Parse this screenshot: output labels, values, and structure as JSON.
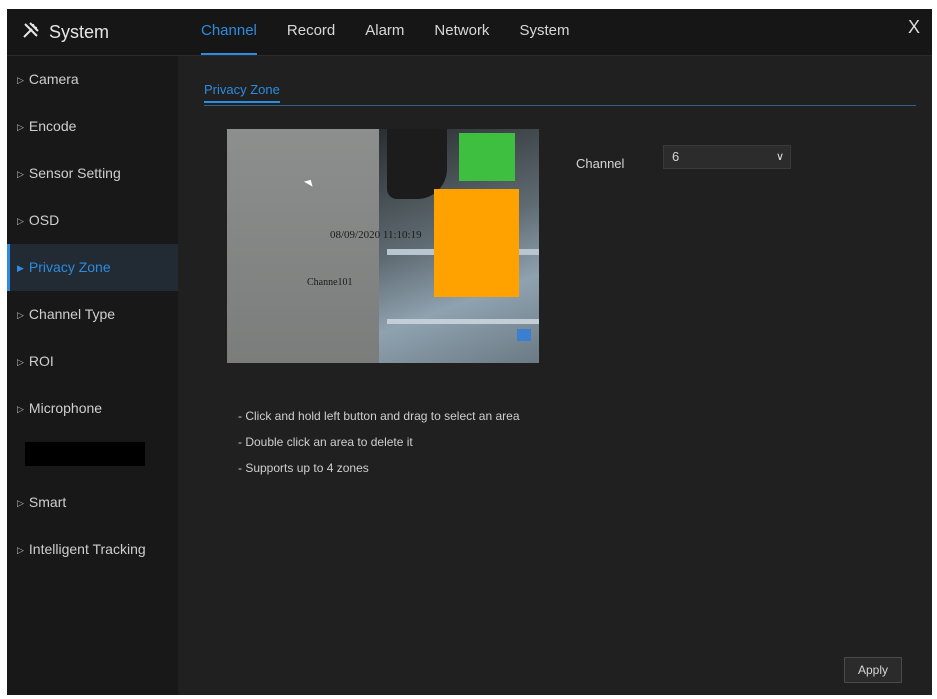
{
  "window": {
    "title": "System",
    "close_label": "X"
  },
  "tabs": [
    {
      "label": "Channel",
      "active": true
    },
    {
      "label": "Record"
    },
    {
      "label": "Alarm"
    },
    {
      "label": "Network"
    },
    {
      "label": "System"
    }
  ],
  "sidebar": {
    "items": [
      {
        "label": "Camera"
      },
      {
        "label": "Encode"
      },
      {
        "label": "Sensor Setting"
      },
      {
        "label": "OSD"
      },
      {
        "label": "Privacy Zone",
        "active": true
      },
      {
        "label": "Channel Type"
      },
      {
        "label": "ROI"
      },
      {
        "label": "Microphone"
      },
      {
        "label": "",
        "redacted": true
      },
      {
        "label": "Smart"
      },
      {
        "label": "Intelligent Tracking"
      }
    ]
  },
  "main": {
    "subtab": "Privacy Zone",
    "preview": {
      "osd_time": "08/09/2020 11:10:19",
      "osd_name": "Channe101"
    },
    "channel": {
      "label": "Channel",
      "value": "6"
    },
    "hints": [
      "- Click and hold left button and drag to select an area",
      "- Double click an area to delete it",
      "- Supports up to 4 zones"
    ],
    "apply_label": "Apply"
  },
  "colors": {
    "accent": "#2b8ce0",
    "privacy_mask": "#ffa200",
    "background": "#1f1f1f"
  }
}
